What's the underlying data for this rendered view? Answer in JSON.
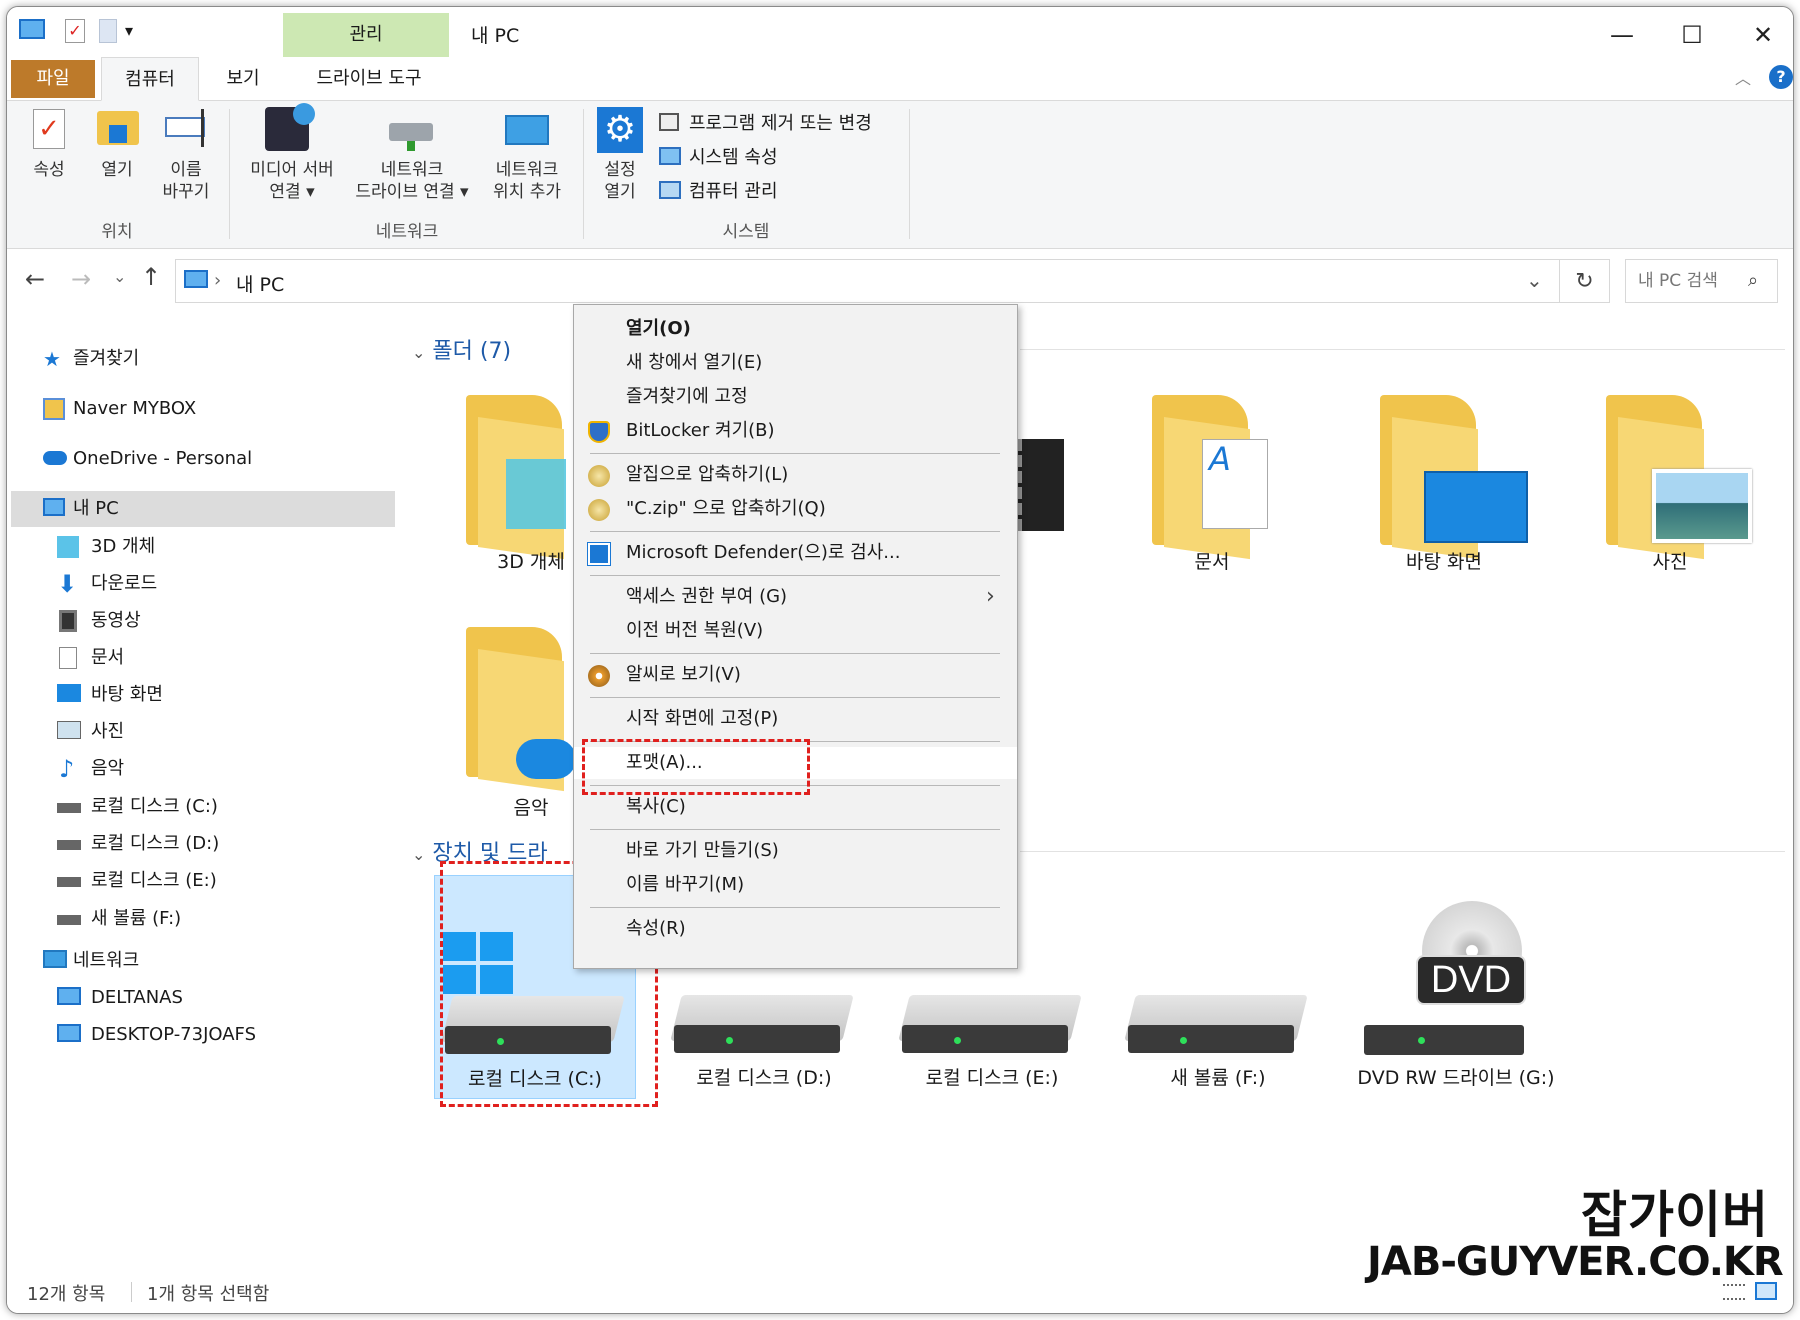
{
  "titlebar": {
    "manage_tab": "관리",
    "title": "내 PC",
    "minimize": "—",
    "maximize": "☐",
    "close": "✕"
  },
  "tabs": {
    "file": "파일",
    "computer": "컴퓨터",
    "view": "보기",
    "drive_tools": "드라이브 도구"
  },
  "ribbon": {
    "properties": "속성",
    "open": "열기",
    "rename_1": "이름",
    "rename_2": "바꾸기",
    "group_location": "위치",
    "media_1": "미디어 서버",
    "media_2": "연결 ▾",
    "map_drive_1": "네트워크",
    "map_drive_2": "드라이브 연결 ▾",
    "add_location_1": "네트워크",
    "add_location_2": "위치 추가",
    "group_network": "네트워크",
    "settings_1": "설정",
    "settings_2": "열기",
    "uninstall": "프로그램 제거 또는 변경",
    "system_props": "시스템 속성",
    "manage": "컴퓨터 관리",
    "group_system": "시스템"
  },
  "address": {
    "path": "내 PC",
    "search_placeholder": "내 PC 검색"
  },
  "nav": {
    "quick_access": "즐겨찾기",
    "naver": "Naver MYBOX",
    "onedrive": "OneDrive - Personal",
    "this_pc": "내 PC",
    "objects3d": "3D 개체",
    "downloads": "다운로드",
    "videos": "동영상",
    "documents": "문서",
    "desktop": "바탕 화면",
    "pictures": "사진",
    "music": "음악",
    "disk_c": "로컬 디스크 (C:)",
    "disk_d": "로컬 디스크 (D:)",
    "disk_e": "로컬 디스크 (E:)",
    "vol_f": "새 볼륨 (F:)",
    "network": "네트워크",
    "deltanas": "DELTANAS",
    "desktop_pc": "DESKTOP-73JOAFS"
  },
  "content": {
    "folders_header": "폴더 (7)",
    "devices_header": "장치 및 드라",
    "folders": {
      "objects3d": "3D 개체",
      "documents": "문서",
      "desktop": "바탕 화면",
      "pictures": "사진",
      "music": "음악"
    },
    "drives": {
      "c": "로컬 디스크 (C:)",
      "d": "로컬 디스크 (D:)",
      "e": "로컬 디스크 (E:)",
      "f": "새 볼륨 (F:)",
      "g": "DVD RW 드라이브 (G:)",
      "dvd_badge": "DVD"
    }
  },
  "context_menu": {
    "open": "열기(O)",
    "open_new_window": "새 창에서 열기(E)",
    "pin_quick": "즐겨찾기에 고정",
    "bitlocker": "BitLocker 켜기(B)",
    "alzip": "알집으로 압축하기(L)",
    "alzip_c": "\"C.zip\" 으로 압축하기(Q)",
    "defender": "Microsoft Defender(으)로 검사...",
    "give_access": "액세스 권한 부여 (G)",
    "restore": "이전 버전 복원(V)",
    "alsee": "알씨로 보기(V)",
    "pin_start": "시작 화면에 고정(P)",
    "format": "포맷(A)...",
    "copy": "복사(C)",
    "shortcut": "바로 가기 만들기(S)",
    "rename": "이름 바꾸기(M)",
    "properties": "속성(R)"
  },
  "status": {
    "items": "12개 항목",
    "selected": "1개 항목 선택함"
  },
  "watermark": {
    "line1": "잡가이버",
    "line2": "JAB-GUYVER.CO.KR"
  },
  "colors": {
    "file_tab": "#bd7a2a",
    "manage_tab": "#cde8b3",
    "selection": "#cce8ff",
    "highlight_dash": "#e0201e",
    "folder_yellow": "#f0c44c",
    "accent_blue": "#1e5aa8"
  }
}
